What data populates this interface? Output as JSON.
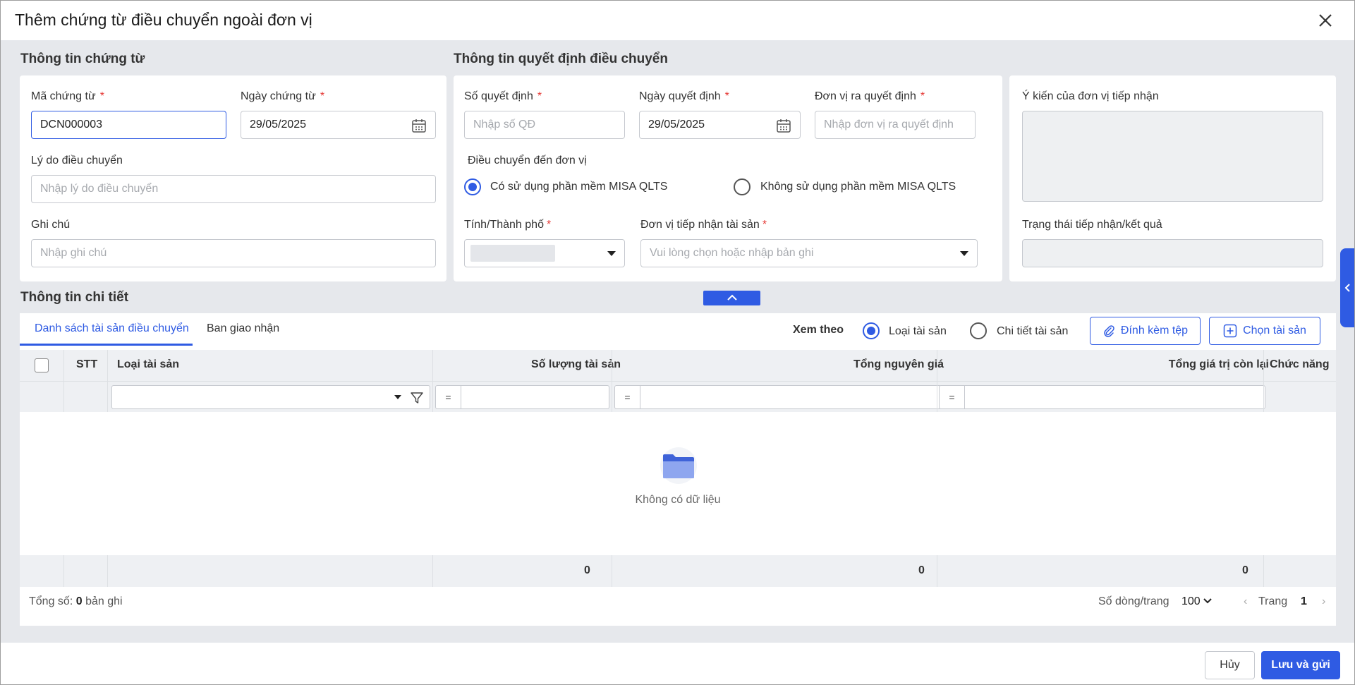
{
  "dialog": {
    "title": "Thêm chứng từ điều chuyển ngoài đơn vị"
  },
  "voucher": {
    "section_title": "Thông tin chứng từ",
    "code_label": "Mã chứng từ",
    "code_value": "DCN000003",
    "date_label": "Ngày chứng từ",
    "date_value": "29/05/2025",
    "reason_label": "Lý do điều chuyển",
    "reason_placeholder": "Nhập lý do điều chuyển",
    "note_label": "Ghi chú",
    "note_placeholder": "Nhập ghi chú"
  },
  "decision": {
    "section_title": "Thông tin quyết định điều chuyển",
    "number_label": "Số quyết định",
    "number_placeholder": "Nhập số QĐ",
    "date_label": "Ngày quyết định",
    "date_value": "29/05/2025",
    "issuer_label": "Đơn vị ra quyết định",
    "issuer_placeholder": "Nhập đơn vị ra quyết định",
    "transfer_to_label": "Điều chuyển đến đơn vị",
    "radio_yes": "Có sử dụng phần mềm MISA QLTS",
    "radio_no": "Không sử dụng phần mềm MISA QLTS",
    "selected_radio": "yes",
    "province_label": "Tính/Thành phố",
    "receiver_label": "Đơn vị tiếp nhận tài sản",
    "receiver_placeholder": "Vui lòng chọn hoặc nhập bản ghi"
  },
  "feedback": {
    "opinion_label": "Ý kiến của đơn vị tiếp nhận",
    "status_label": "Trạng thái tiếp nhận/kết quả"
  },
  "detail": {
    "section_title": "Thông tin chi tiết",
    "tabs": [
      "Danh sách tài sản điều chuyển",
      "Ban giao nhận"
    ],
    "active_tab": 0,
    "view_by_label": "Xem theo",
    "view_by_options": [
      "Loại tài sản",
      "Chi tiết tài sản"
    ],
    "view_by_selected": 0,
    "attach_button": "Đính kèm tệp",
    "select_asset_button": "Chọn tài sản",
    "columns": [
      "STT",
      "Loại tài sản",
      "Số lượng tài sản",
      "Tổng nguyên giá",
      "Tổng giá trị còn lại",
      "Chức năng"
    ],
    "filter_operator": "=",
    "empty_text": "Không có dữ liệu",
    "totals": {
      "quantity": "0",
      "original_price": "0",
      "remaining_value": "0"
    },
    "total_records_label": "Tổng số:",
    "total_records_value": "0",
    "total_records_unit": "bản ghi",
    "rows_per_page_label": "Số dòng/trang",
    "rows_per_page_value": "100",
    "page_label": "Trang",
    "page_value": "1"
  },
  "footer": {
    "cancel_button": "Hủy",
    "save_button": "Lưu và gửi"
  },
  "colors": {
    "accent": "#2f5be3",
    "required": "#e53935"
  }
}
